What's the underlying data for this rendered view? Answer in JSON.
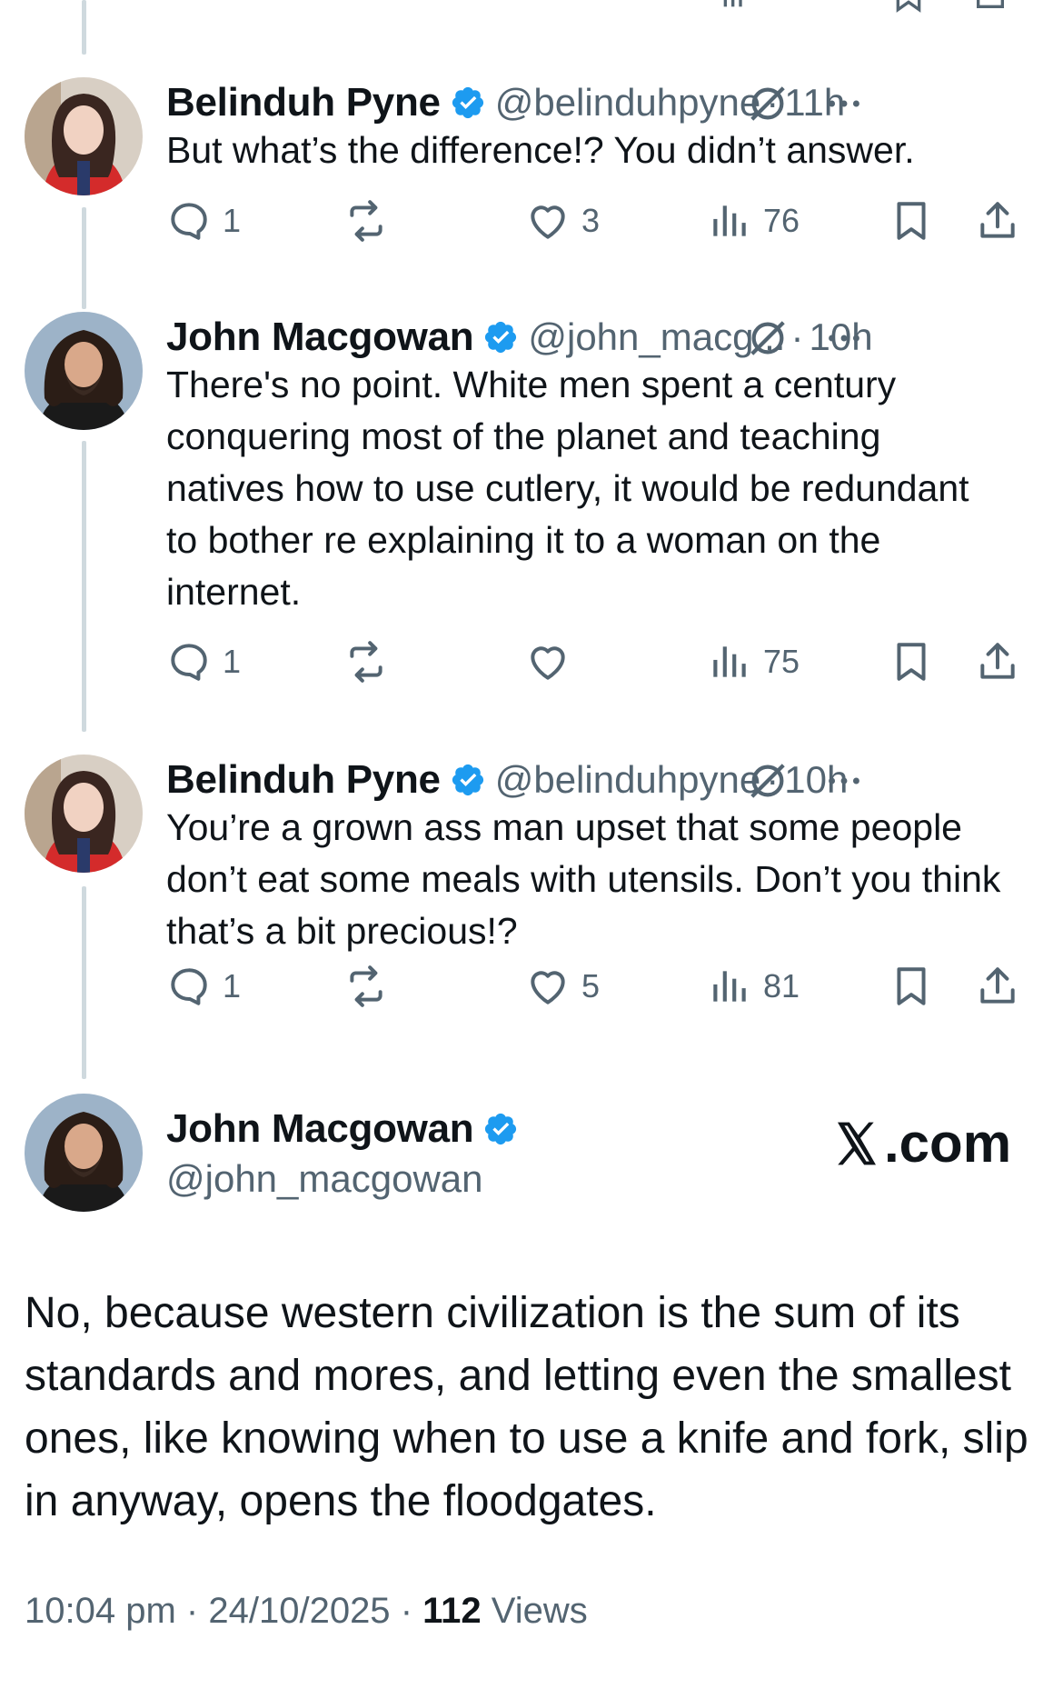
{
  "replies": [
    {
      "author_name": "Belinduh Pyne",
      "handle": "@belinduhpyne",
      "time": "11h",
      "text": "But what’s the difference!? You didn’t answer.",
      "replies": "1",
      "reposts": "",
      "likes": "3",
      "views": "76"
    },
    {
      "author_name": "John Macgowan",
      "handle": "@john_macg...",
      "time": "10h",
      "text": "There's no point. White men spent a century conquering most of the planet and teaching natives how to use cutlery, it would be redundant to bother re explaining it to a woman on the internet.",
      "replies": "1",
      "reposts": "",
      "likes": "",
      "views": "75"
    },
    {
      "author_name": "Belinduh Pyne",
      "handle": "@belinduhpyne",
      "time": "10h",
      "text": "You’re a grown ass man upset that some people don’t eat some meals with utensils. Don’t you think that’s a bit precious!?",
      "replies": "1",
      "reposts": "",
      "likes": "5",
      "views": "81"
    }
  ],
  "main_tweet": {
    "author_name": "John Macgowan",
    "handle": "@john_macgowan",
    "watermark": ".com",
    "text": "No, because western civilization is the sum of its standards and mores, and letting even the smallest ones, like knowing when to use a knife and fork, slip in anyway, opens the floodgates.",
    "time": "10:04 pm",
    "date": "24/10/2025",
    "views_count": "112",
    "views_label": "Views"
  },
  "separator": "·",
  "colors": {
    "verified": "#1d9bf0",
    "muted": "#536471",
    "text": "#0f1419",
    "thread_line": "#cfd9de"
  },
  "icons": [
    "reply-icon",
    "repost-icon",
    "like-icon",
    "views-icon",
    "bookmark-icon",
    "share-icon",
    "verified-icon",
    "grok-icon",
    "more-icon",
    "x-logo-icon"
  ]
}
